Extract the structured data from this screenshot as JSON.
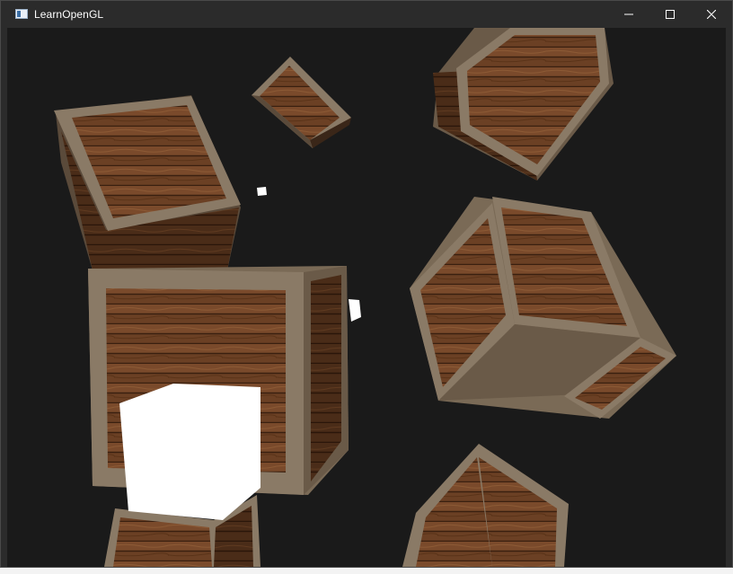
{
  "window": {
    "title": "LearnOpenGL",
    "icon": "application-window-icon",
    "controls": [
      "minimize-icon",
      "maximize-icon",
      "close-icon"
    ]
  },
  "scene": {
    "clear_color": "#1a1a1a",
    "crate_wood": "#6b4024",
    "crate_frame": "#8a7a66",
    "light_color": "#ffffff"
  }
}
